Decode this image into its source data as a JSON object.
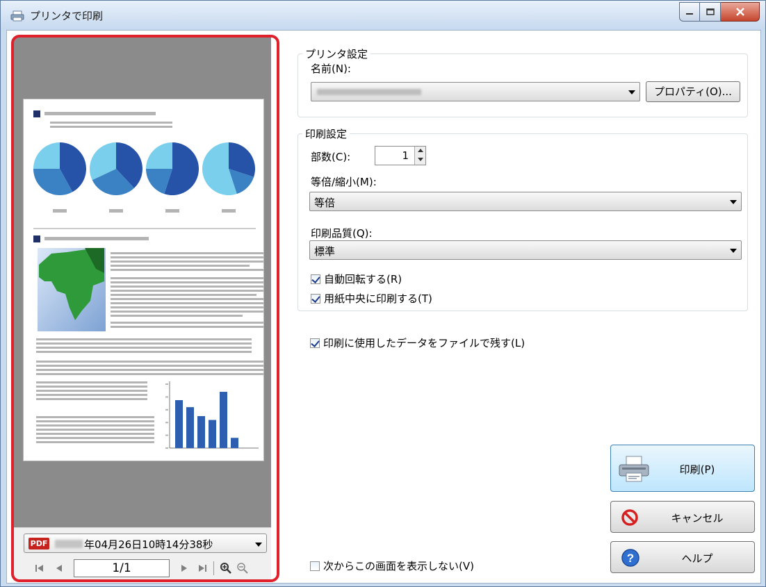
{
  "window": {
    "title": "プリンタで印刷",
    "min_label": "▁",
    "max_label": "□",
    "close_label": "✕"
  },
  "preview": {
    "file_badge": "PDF",
    "file_name": "年04月26日10時14分38秒",
    "page_indicator": "1/1",
    "nav_icons": [
      "first-page-icon",
      "prev-page-icon",
      "next-page-icon",
      "last-page-icon",
      "zoom-in-icon",
      "zoom-out-icon"
    ]
  },
  "printer_settings": {
    "group_title": "プリンタ設定",
    "name_label": "名前(N):",
    "properties_button": "プロパティ(O)..."
  },
  "print_settings": {
    "group_title": "印刷設定",
    "copies_label": "部数(C):",
    "copies_value": "1",
    "scale_label": "等倍/縮小(M):",
    "scale_value": "等倍",
    "quality_label": "印刷品質(Q):",
    "quality_value": "標準",
    "auto_rotate_label": "自動回転する(R)",
    "auto_rotate_checked": true,
    "center_label": "用紙中央に印刷する(T)",
    "center_checked": true
  },
  "keep_data_label": "印刷に使用したデータをファイルで残す(L)",
  "keep_data_checked": true,
  "dont_show_label": "次からこの画面を表示しない(V)",
  "dont_show_checked": false,
  "buttons": {
    "print": "印刷(P)",
    "cancel": "キャンセル",
    "help": "ヘルプ"
  },
  "colors": {
    "highlight_frame": "#e0202a",
    "pie_dark": "#2652a8",
    "pie_mid": "#3b82c4",
    "pie_light": "#7ad0ec",
    "bar_blue": "#2c5fb0"
  },
  "chart_data": {
    "type": "bar",
    "values": [
      75,
      64,
      50,
      44,
      88,
      16
    ],
    "ylim": [
      0,
      100
    ]
  },
  "pie_charts": [
    [
      0.42,
      0.33,
      0.25
    ],
    [
      0.38,
      0.3,
      0.32
    ],
    [
      0.55,
      0.2,
      0.25
    ],
    [
      0.3,
      0.15,
      0.55
    ]
  ]
}
